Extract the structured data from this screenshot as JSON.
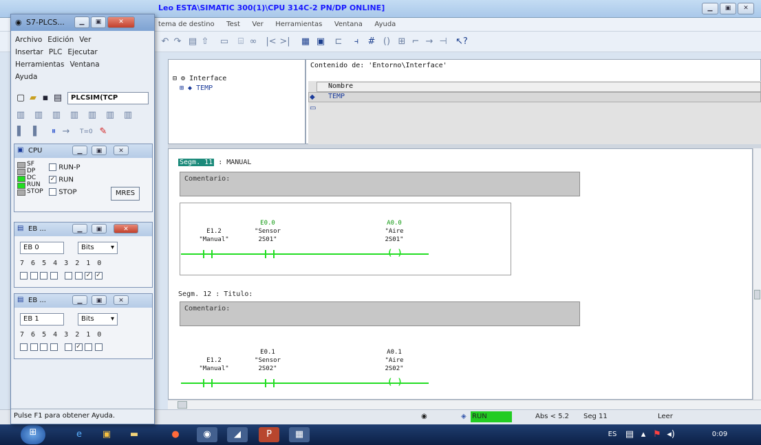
{
  "main_window": {
    "title": "Leo ESTA\\SIMATIC 300(1)\\CPU 314C-2 PN/DP  ONLINE]",
    "menu": [
      "tema de destino",
      "Test",
      "Ver",
      "Herramientas",
      "Ventana",
      "Ayuda"
    ]
  },
  "tree": {
    "root": "Interface",
    "child": "TEMP"
  },
  "list": {
    "header": "Contenido de: 'Entorno\\Interface'",
    "column": "Nombre",
    "row": "TEMP"
  },
  "segments": [
    {
      "label": "Segm. 11",
      "title": ": MANUAL",
      "comment": "Comentario:",
      "contacts": [
        {
          "addr": "E1.2",
          "sym": "\"Manual\""
        },
        {
          "addr": "E0.0",
          "sym": "\"Sensor\n2S01\""
        }
      ],
      "coil": {
        "addr": "A0.0",
        "sym": "\"Aire\n2S01\""
      }
    },
    {
      "label": "Segm. 12",
      "title": ": Titulo:",
      "comment": "Comentario:",
      "contacts": [
        {
          "addr": "E1.2",
          "sym": "\"Manual\""
        },
        {
          "addr": "E0.1",
          "sym": "\"Sensor\n2S02\""
        }
      ],
      "coil": {
        "addr": "A0.1",
        "sym": "\"Aire\n2S02\""
      }
    }
  ],
  "status": {
    "mode": "RUN",
    "abs": "Abs < 5.2",
    "seg": "Seg 11",
    "rw": "Leer"
  },
  "plcsim": {
    "title": "S7-PLCS...",
    "menu": [
      "Archivo",
      "Edición",
      "Ver",
      "Insertar",
      "PLC",
      "Ejecutar",
      "Herramientas",
      "Ventana",
      "Ayuda"
    ],
    "connection": "PLCSIM(TCP",
    "status_text": "Pulse F1 para obtener Ayuda.",
    "cpu": {
      "title": "CPU",
      "leds": [
        "SF",
        "DP",
        "DC",
        "RUN",
        "STOP"
      ],
      "runp": "RUN-P",
      "run": "RUN",
      "stop": "STOP",
      "mres": "MRES"
    },
    "eb0": {
      "title": "EB ...",
      "addr": "EB   0",
      "format": "Bits",
      "bits": "7 6 5 4   3 2 1 0"
    },
    "eb1": {
      "title": "EB ...",
      "addr": "EB   1",
      "format": "Bits",
      "bits": "7 6 5 4   3 2 1 0"
    }
  },
  "taskbar": {
    "lang": "ES",
    "time": "0:09"
  },
  "colors": {
    "rung": "#22dd22",
    "run_green": "#22cc22",
    "title_text": "#1a1aff"
  }
}
